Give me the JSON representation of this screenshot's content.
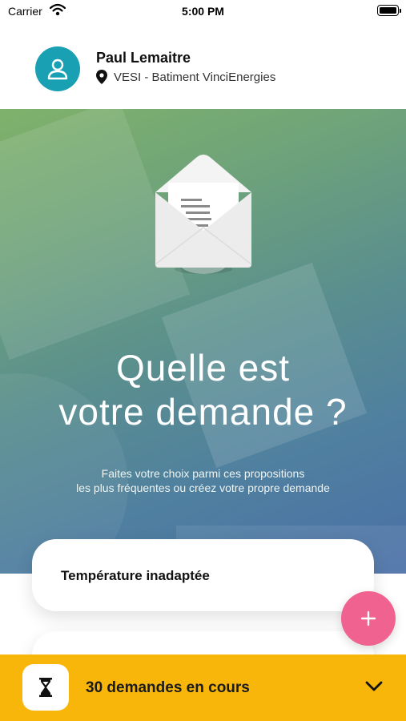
{
  "status_bar": {
    "carrier": "Carrier",
    "time": "5:00 PM"
  },
  "header": {
    "user_name": "Paul Lemaitre",
    "location": "VESI - Batiment VinciEnergies"
  },
  "hero": {
    "title_line1": "Quelle est",
    "title_line2": "votre demande ?",
    "subtitle_line1": "Faites votre choix parmi ces propositions",
    "subtitle_line2": "les plus fréquentes ou créez votre propre demande"
  },
  "suggestions": [
    {
      "label": "Température inadaptée"
    },
    {
      "label": ""
    }
  ],
  "fab": {
    "label": "+"
  },
  "bottom_bar": {
    "requests_label": "30 demandes en cours"
  },
  "icons": [
    "wifi-icon",
    "battery-icon",
    "user-icon",
    "location-pin-icon",
    "envelope-illustration",
    "plus-icon",
    "hourglass-icon",
    "chevron-down-icon"
  ],
  "colors": {
    "avatar": "#1aa0b3",
    "fab": "#f0628f",
    "bottom_bar": "#f8b60b",
    "hero_start": "#7fb26a",
    "hero_end": "#4a6fa7"
  }
}
